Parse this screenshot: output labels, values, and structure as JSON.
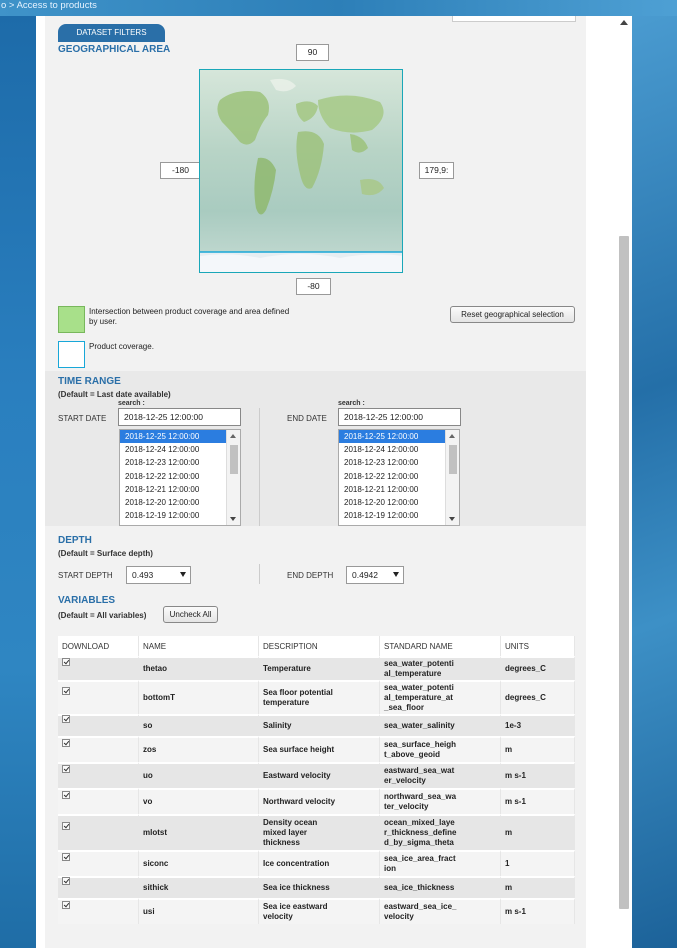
{
  "breadcrumb": "o > Access to products",
  "filters_tab": "DATASET FILTERS",
  "geo": {
    "title": "GEOGRAPHICAL AREA",
    "north": "90",
    "south": "-80",
    "west": "-180",
    "east": "179,9:",
    "legend_intersection": "Intersection between product coverage and area defined by user.",
    "legend_coverage": "Product coverage.",
    "reset_button": "Reset geographical selection",
    "colors": {
      "intersection": "#a8e08a",
      "coverage": "#18a7d8",
      "accent": "#2a6fa8"
    }
  },
  "time": {
    "title": "TIME RANGE",
    "subtitle": "(Default = Last date available)",
    "start_label": "START DATE",
    "end_label": "END DATE",
    "search_label": "search :",
    "start_value": "2018-12-25 12:00:00",
    "end_value": "2018-12-25 12:00:00",
    "dates": [
      "2018-12-25 12:00:00",
      "2018-12-24 12:00:00",
      "2018-12-23 12:00:00",
      "2018-12-22 12:00:00",
      "2018-12-21 12:00:00",
      "2018-12-20 12:00:00",
      "2018-12-19 12:00:00"
    ]
  },
  "depth": {
    "title": "DEPTH",
    "subtitle": "(Default = Surface depth)",
    "start_label": "START DEPTH",
    "start_value": "0.493",
    "end_label": "END DEPTH",
    "end_value": "0.4942"
  },
  "variables": {
    "title": "VARIABLES",
    "subtitle": "(Default = All variables)",
    "uncheck_button": "Uncheck All",
    "columns": [
      "DOWNLOAD",
      "NAME",
      "DESCRIPTION",
      "STANDARD NAME",
      "UNITS"
    ],
    "rows": [
      {
        "name": "thetao",
        "description": "Temperature",
        "standard": "sea_water_potenti\nal_temperature",
        "units": "degrees_C"
      },
      {
        "name": "bottomT",
        "description": "Sea floor potential\ntemperature",
        "standard": "sea_water_potenti\nal_temperature_at\n_sea_floor",
        "units": "degrees_C"
      },
      {
        "name": "so",
        "description": "Salinity",
        "standard": "sea_water_salinity",
        "units": "1e-3"
      },
      {
        "name": "zos",
        "description": "Sea surface height",
        "standard": "sea_surface_heigh\nt_above_geoid",
        "units": "m"
      },
      {
        "name": "uo",
        "description": "Eastward velocity",
        "standard": "eastward_sea_wat\ner_velocity",
        "units": "m s-1"
      },
      {
        "name": "vo",
        "description": "Northward velocity",
        "standard": "northward_sea_wa\nter_velocity",
        "units": "m s-1"
      },
      {
        "name": "mlotst",
        "description": "Density ocean\nmixed layer\nthickness",
        "standard": "ocean_mixed_laye\nr_thickness_define\nd_by_sigma_theta",
        "units": "m"
      },
      {
        "name": "siconc",
        "description": "Ice concentration",
        "standard": "sea_ice_area_fract\nion",
        "units": "1"
      },
      {
        "name": "sithick",
        "description": "Sea ice thickness",
        "standard": "sea_ice_thickness",
        "units": "m"
      },
      {
        "name": "usi",
        "description": "Sea ice eastward\nvelocity",
        "standard": "eastward_sea_ice_\nvelocity",
        "units": "m s-1"
      }
    ]
  }
}
